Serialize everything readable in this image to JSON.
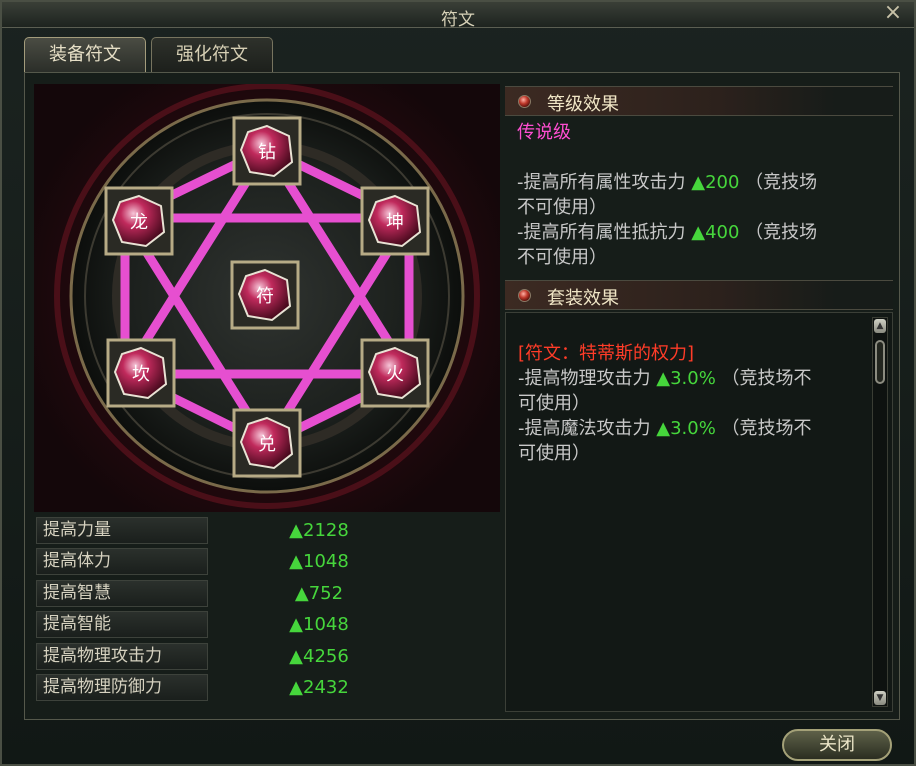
{
  "window": {
    "title": "符文",
    "close_symbol": "×"
  },
  "tabs": [
    {
      "label": "装备符文",
      "active": true
    },
    {
      "label": "强化符文",
      "active": false
    }
  ],
  "runes": {
    "slots": [
      {
        "glyph": "钻"
      },
      {
        "glyph": "龙"
      },
      {
        "glyph": "坤"
      },
      {
        "glyph": "符"
      },
      {
        "glyph": "坎"
      },
      {
        "glyph": "火"
      },
      {
        "glyph": "兑"
      }
    ]
  },
  "stats": [
    {
      "label": "提高力量",
      "value": "▲2128"
    },
    {
      "label": "提高体力",
      "value": "▲1048"
    },
    {
      "label": "提高智慧",
      "value": "▲752"
    },
    {
      "label": "提高智能",
      "value": "▲1048"
    },
    {
      "label": "提高物理攻击力",
      "value": "▲4256"
    },
    {
      "label": "提高物理防御力",
      "value": "▲2432"
    }
  ],
  "grade_effect": {
    "header": "等级效果",
    "grade": "传说级",
    "line1_prefix": "-提高所有属性攻击力",
    "line1_value": "▲200",
    "line1_suffix": "（竞技场",
    "line1_cont": "不可使用）",
    "line2_prefix": "-提高所有属性抵抗力",
    "line2_value": "▲400",
    "line2_suffix": "（竞技场",
    "line2_cont": "不可使用）"
  },
  "set_effect": {
    "header": "套装效果",
    "set_name": "[符文：特蒂斯的权力]",
    "line1_prefix": "-提高物理攻击力",
    "line1_value": "▲3.0%",
    "line1_suffix": "（竞技场不",
    "line1_cont": "可使用）",
    "line2_prefix": "-提高魔法攻击力",
    "line2_value": "▲3.0%",
    "line2_suffix": "（竞技场不",
    "line2_cont": "可使用）"
  },
  "footer": {
    "close_label": "关闭"
  },
  "colors": {
    "accent_pink": "#ff4ed1",
    "stat_green": "#46d63c",
    "set_red": "#ff3c28",
    "rune_crimson": "#8e1a3a"
  }
}
